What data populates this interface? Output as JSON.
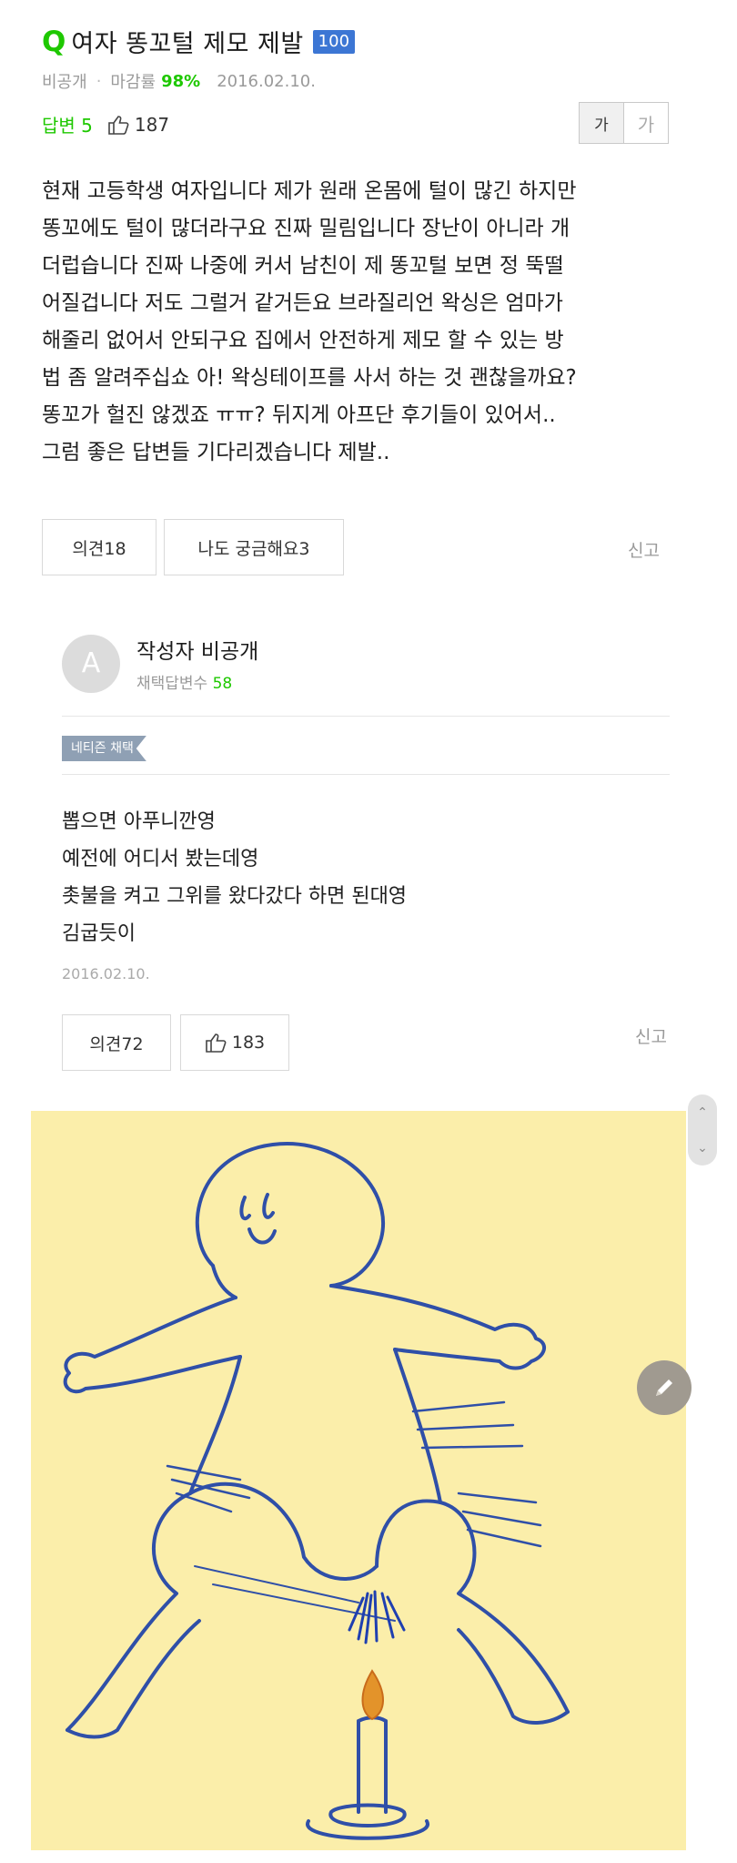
{
  "question": {
    "q_mark": "Q",
    "title": "여자 똥꼬털 제모 제발",
    "points": "100",
    "visibility": "비공개",
    "separator": "·",
    "deadline_label": "마감률",
    "deadline_pct": "98%",
    "date": "2016.02.10.",
    "answers": "답변 5",
    "likes": "187",
    "font_small": "가",
    "font_large": "가",
    "body": [
      "현재 고등학생 여자입니다 제가 원래 온몸에 털이 많긴 하지만",
      "똥꼬에도 털이 많더라구요 진짜 밀림입니다 장난이 아니라 개",
      "더럽습니다 진짜 나중에 커서 남친이 제 똥꼬털 보면 정 뚝떨",
      "어질겁니다 저도 그럴거 같거든요 브라질리언 왁싱은 엄마가",
      "해줄리 없어서 안되구요 집에서 안전하게 제모 할 수 있는 방",
      "법 좀 알려주십쇼 아! 왁싱테이프를 사서 하는 것 괜찮을까요?",
      "똥꼬가 헐진 않겠죠 ㅠㅠ? 뒤지게 아프단 후기들이 있어서..",
      "그럼 좋은 답변들 기다리겠습니다 제발.."
    ],
    "opinion_btn": "의견18",
    "curious_btn": "나도 궁금해요3",
    "report": "신고"
  },
  "answer": {
    "avatar_letter": "A",
    "author": "작성자 비공개",
    "selected_label": "채택답변수",
    "selected_count": "58",
    "tag": "네티즌 채택",
    "body": [
      "뽑으면 아푸니깐영",
      "예전에 어디서 봤는데영",
      "촛불을 켜고 그위를 왔다갔다 하면 된대영",
      "김굽듯이"
    ],
    "date": "2016.02.10.",
    "opinion_btn": "의견72",
    "likes": "183",
    "report": "신고"
  },
  "scroll": {
    "up": "⌃",
    "down": "⌄"
  },
  "colors": {
    "accent": "#1ec800",
    "badge": "#3c76d4",
    "illustration_bg": "#fbeeaa",
    "line": "#2f4fa8"
  }
}
